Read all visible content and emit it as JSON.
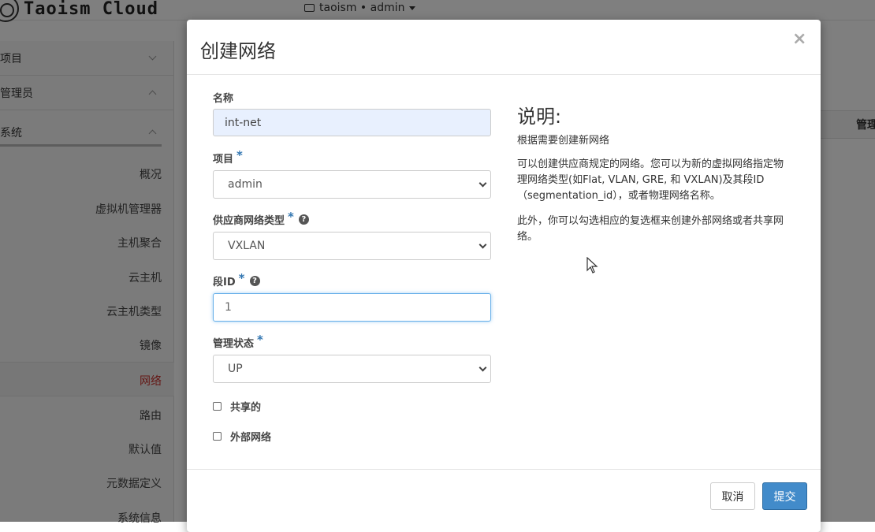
{
  "app": {
    "logo_text": "Taoism Cloud",
    "project_switcher": "taoism • admin"
  },
  "sidebar": {
    "groups": [
      {
        "label": "项目",
        "expanded": false
      },
      {
        "label": "管理员",
        "expanded": true
      },
      {
        "label": "系统",
        "expanded": true
      }
    ],
    "items": [
      {
        "label": "概况",
        "active": false
      },
      {
        "label": "虚拟机管理器",
        "active": false
      },
      {
        "label": "主机聚合",
        "active": false
      },
      {
        "label": "云主机",
        "active": false
      },
      {
        "label": "云主机类型",
        "active": false
      },
      {
        "label": "镜像",
        "active": false
      },
      {
        "label": "网络",
        "active": true
      },
      {
        "label": "路由",
        "active": false
      },
      {
        "label": "默认值",
        "active": false
      },
      {
        "label": "元数据定义",
        "active": false
      },
      {
        "label": "系统信息",
        "active": false
      }
    ]
  },
  "background": {
    "table_header_partial": "管理"
  },
  "modal": {
    "title": "创建网络",
    "close": "×",
    "fields": {
      "name": {
        "label": "名称",
        "value": "int-net"
      },
      "project": {
        "label": "项目",
        "required": "*",
        "value": "admin"
      },
      "provider_type": {
        "label": "供应商网络类型",
        "required": "*",
        "help": "?",
        "value": "VXLAN"
      },
      "segment_id": {
        "label": "段ID",
        "required": "*",
        "help": "?",
        "value": "1"
      },
      "admin_state": {
        "label": "管理状态",
        "required": "*",
        "value": "UP"
      }
    },
    "checkboxes": {
      "shared": {
        "label": "共享的",
        "checked": false
      },
      "external": {
        "label": "外部网络",
        "checked": false
      }
    },
    "description": {
      "title": "说明:",
      "p1": "根据需要创建新网络",
      "p2": "可以创建供应商规定的网络。您可以为新的虚拟网络指定物理网络类型(如Flat, VLAN, GRE, 和 VXLAN)及其段ID（segmentation_id），或者物理网络名称。",
      "p3": "此外，你可以勾选相应的复选框来创建外部网络或者共享网络。"
    },
    "buttons": {
      "cancel": "取消",
      "submit": "提交"
    }
  },
  "colors": {
    "overlay": "#000000",
    "primary": "#428bca",
    "required": "#3276b1",
    "active_nav": "#c9302c"
  }
}
